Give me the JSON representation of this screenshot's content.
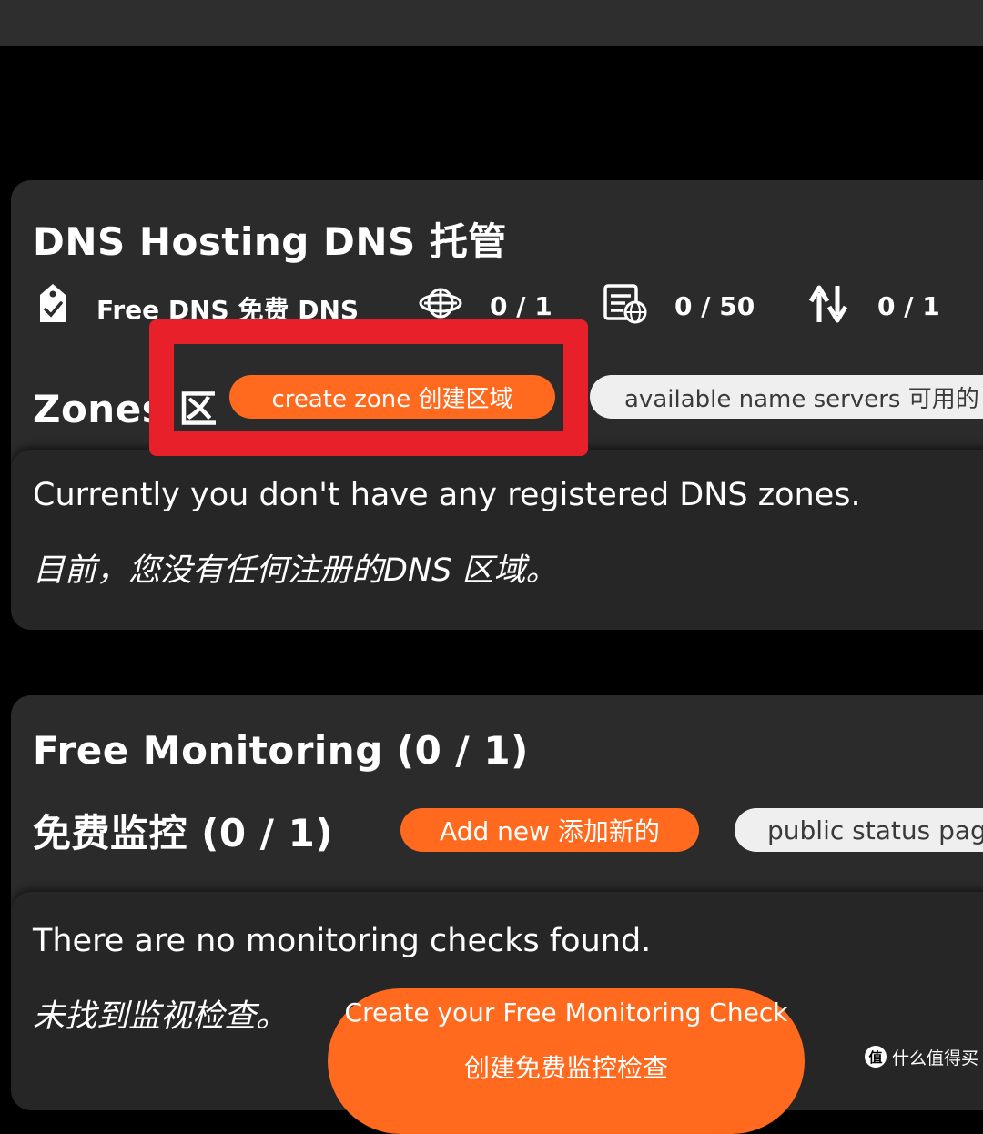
{
  "dns": {
    "title": "DNS Hosting  DNS 托管",
    "plan_label": "Free DNS  免费 DNS",
    "stats": [
      {
        "icon": "globe-icon",
        "value": "0 / 1"
      },
      {
        "icon": "records-icon",
        "value": "0 / 50"
      },
      {
        "icon": "transfer-icon",
        "value": "0 / 1"
      }
    ],
    "zones_heading": "Zones  区",
    "create_zone_button": "create zone  创建区域",
    "name_servers_button": "available name servers  可用的",
    "empty_message_en": "Currently you don't have any registered DNS zones.",
    "empty_message_zh": "目前，您没有任何注册的DNS 区域。"
  },
  "monitoring": {
    "title": "Free Monitoring (0 / 1)",
    "subtitle": "免费监控  (0 / 1)",
    "add_new_button": "Add new  添加新的",
    "status_page_button": "public status page",
    "empty_message_en": "There are no monitoring checks found.",
    "empty_message_zh": "未找到监视检查。",
    "cta_line1": "Create your Free Monitoring Check",
    "cta_line2": "创建免费监控检查"
  },
  "watermark": {
    "logo_glyph": "值",
    "text": "什么值得买"
  },
  "colors": {
    "accent_orange": "#ff6a1f",
    "highlight_red": "#e8202a",
    "card_bg": "#2b2b2b",
    "page_bg": "#000000"
  }
}
